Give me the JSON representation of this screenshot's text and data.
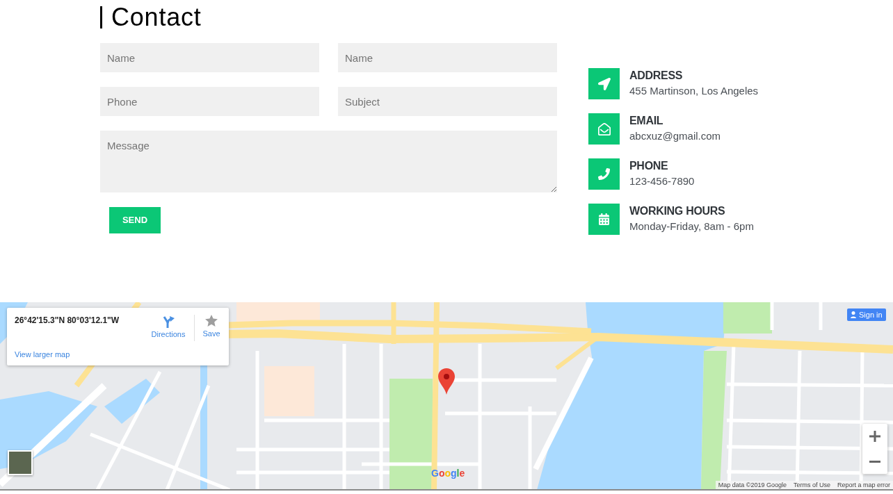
{
  "heading": {
    "title": "Contact"
  },
  "form": {
    "fields": [
      {
        "kind": "input",
        "placeholder": "Name"
      },
      {
        "kind": "input",
        "placeholder": "Name"
      },
      {
        "kind": "input",
        "placeholder": "Phone"
      },
      {
        "kind": "input",
        "placeholder": "Subject"
      },
      {
        "kind": "textarea",
        "placeholder": "Message"
      }
    ],
    "submit": "SEND"
  },
  "contact_info": [
    {
      "title": "ADDRESS",
      "value": "455 Martinson, Los Angeles"
    },
    {
      "title": "EMAIL",
      "value": "abcxuz@gmail.com"
    },
    {
      "title": "PHONE",
      "value": "123-456-7890"
    },
    {
      "title": "WORKING HOURS",
      "value": "Monday-Friday, 8am - 6pm"
    }
  ],
  "map": {
    "info_card": {
      "coordinates": "26°42'15.3\"N 80°03'12.1\"W",
      "actions": [
        "Directions",
        "Save"
      ],
      "link": "View larger map"
    },
    "sign_in": "Sign in",
    "logo": "Google",
    "attribution": [
      "Map data ©2019 Google",
      "Terms of Use",
      "Report a map error"
    ]
  }
}
